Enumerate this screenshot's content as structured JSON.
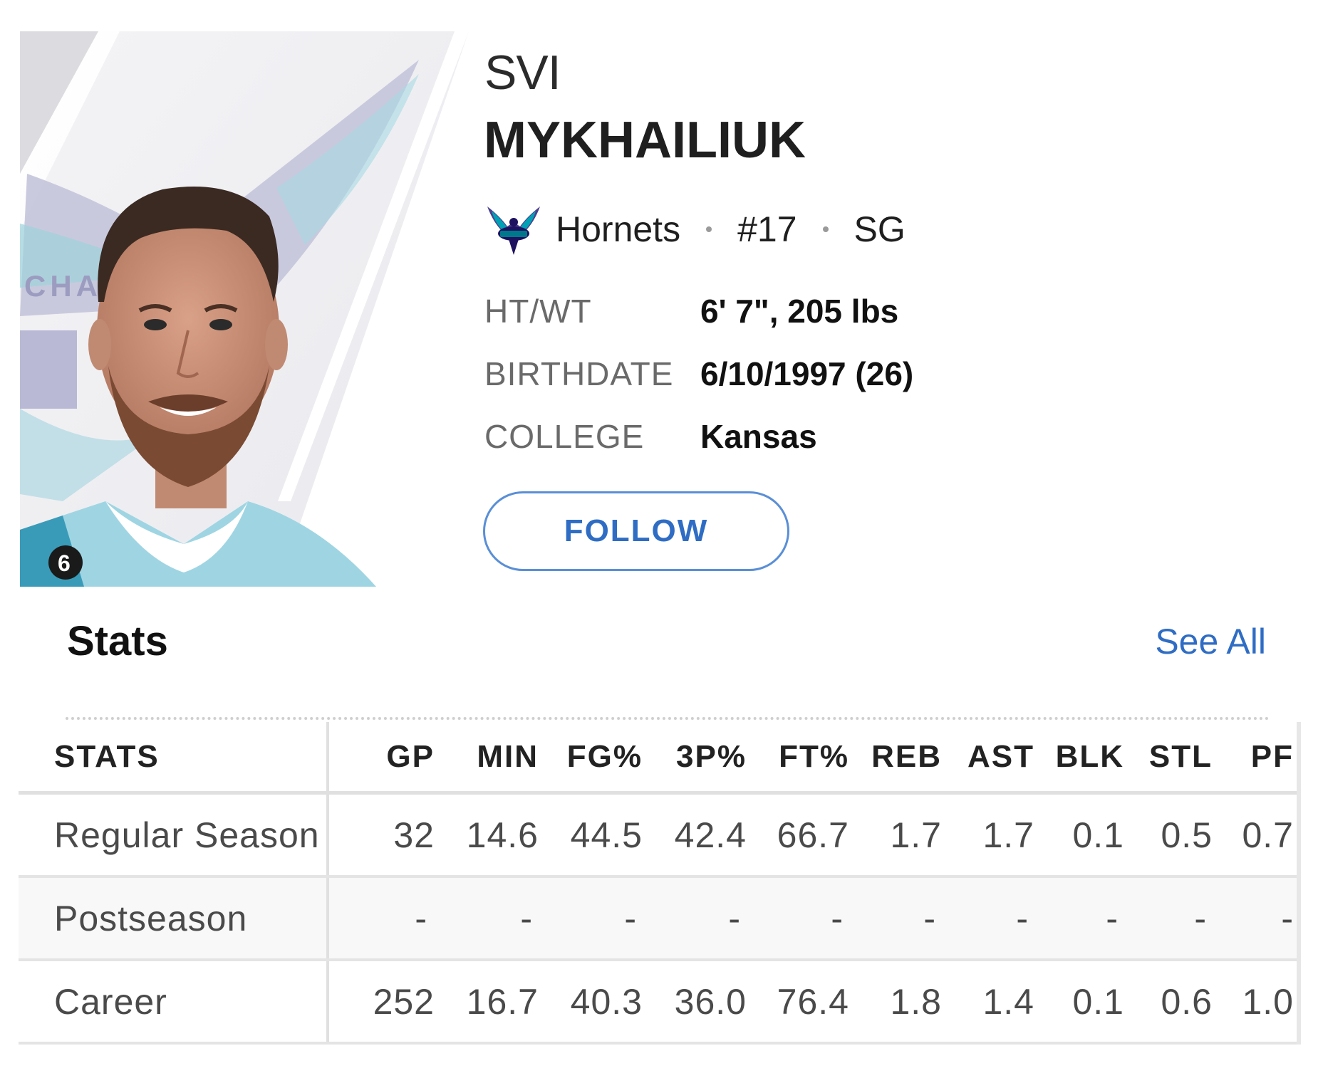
{
  "player": {
    "first_name": "SVI",
    "last_name": "MYKHAILIUK",
    "team": "Hornets",
    "number": "#17",
    "position": "SG",
    "jersey_number_on_photo": "6"
  },
  "info": [
    {
      "label": "HT/WT",
      "value": "6' 7\", 205 lbs"
    },
    {
      "label": "BIRTHDATE",
      "value": "6/10/1997 (26)"
    },
    {
      "label": "COLLEGE",
      "value": "Kansas"
    }
  ],
  "follow_label": "FOLLOW",
  "stats_section": {
    "title": "Stats",
    "see_all": "See All",
    "columns": [
      "STATS",
      "GP",
      "MIN",
      "FG%",
      "3P%",
      "FT%",
      "REB",
      "AST",
      "BLK",
      "STL",
      "PF"
    ],
    "rows": [
      {
        "label": "Regular Season",
        "values": [
          "32",
          "14.6",
          "44.5",
          "42.4",
          "66.7",
          "1.7",
          "1.7",
          "0.1",
          "0.5",
          "0.7"
        ]
      },
      {
        "label": "Postseason",
        "values": [
          "-",
          "-",
          "-",
          "-",
          "-",
          "-",
          "-",
          "-",
          "-",
          "-"
        ]
      },
      {
        "label": "Career",
        "values": [
          "252",
          "16.7",
          "40.3",
          "36.0",
          "76.4",
          "1.8",
          "1.4",
          "0.1",
          "0.6",
          "1.0"
        ]
      }
    ]
  },
  "colors": {
    "accent_blue": "#2f6dc4",
    "hornets_teal": "#00788c",
    "hornets_purple": "#1d1160",
    "label_gray": "#6a6a6a"
  },
  "icons": {
    "team_logo": "hornets-logo-icon"
  }
}
